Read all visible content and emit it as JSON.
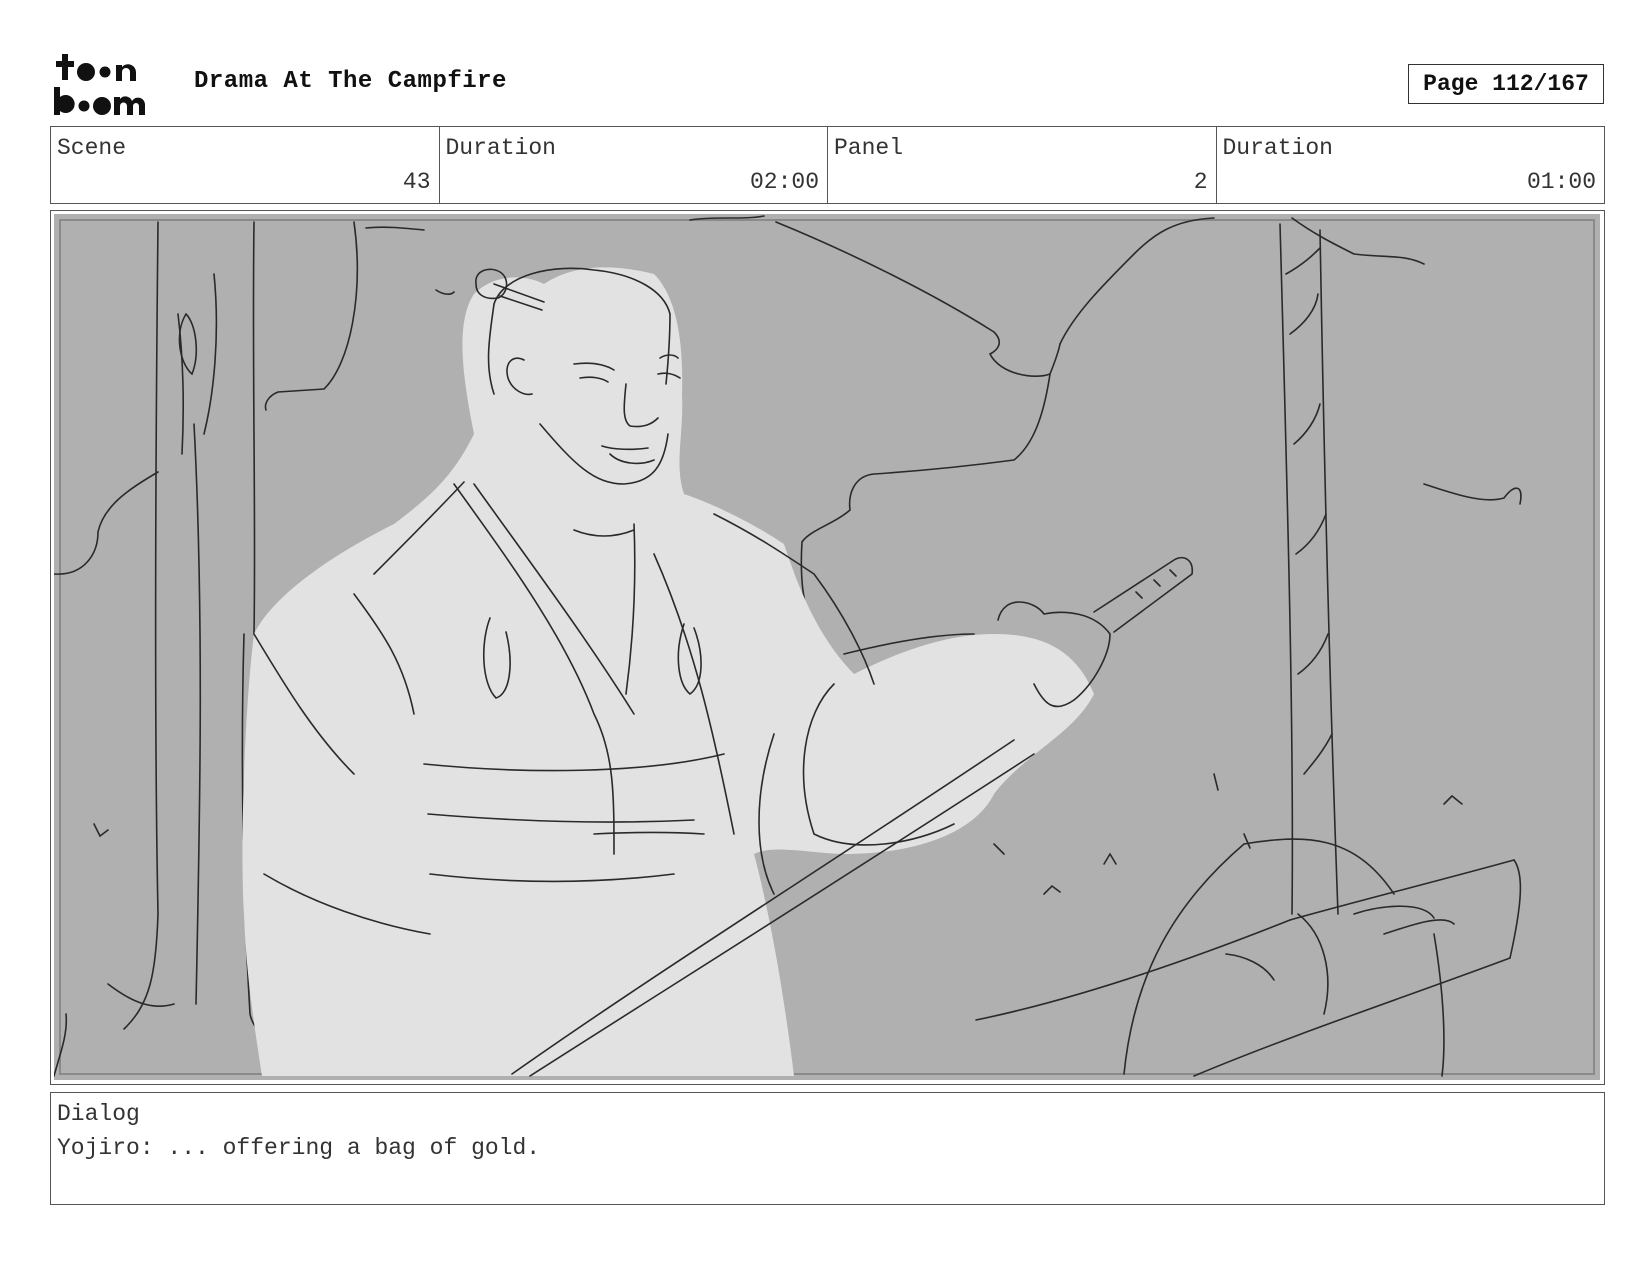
{
  "header": {
    "logo_text_top": "toon",
    "logo_text_bottom": "boom",
    "title": "Drama At The Campfire",
    "page": "Page 112/167"
  },
  "info": {
    "scene_label": "Scene",
    "scene_value": "43",
    "scene_duration_label": "Duration",
    "scene_duration_value": "02:00",
    "panel_label": "Panel",
    "panel_value": "2",
    "panel_duration_label": "Duration",
    "panel_duration_value": "01:00"
  },
  "dialog": {
    "label": "Dialog",
    "text": "Yojiro: ... offering a bag of gold."
  }
}
